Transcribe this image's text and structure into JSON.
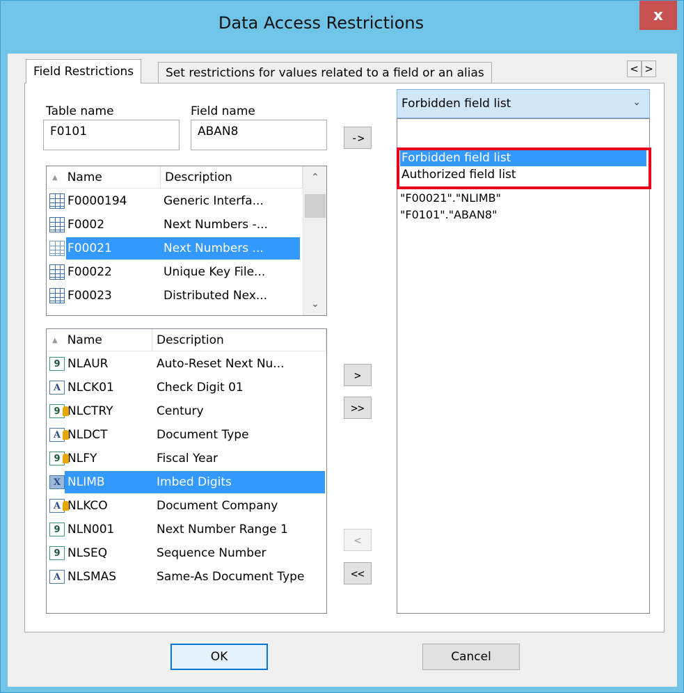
{
  "window": {
    "title": "Data Access Restrictions",
    "close": "x"
  },
  "tabs": [
    {
      "label": "Field Restrictions"
    },
    {
      "label": "Set restrictions for values related to a field or an alias"
    }
  ],
  "tab_scroll": {
    "left": "<",
    "right": ">"
  },
  "table_name": {
    "label": "Table name",
    "value": "F0101"
  },
  "field_name": {
    "label": "Field name",
    "value": "ABAN8"
  },
  "arrow_button": "->",
  "tables_list": {
    "headers": [
      "Name",
      "Description"
    ],
    "rows": [
      {
        "name": "F0000194",
        "desc": "Generic Interfa...",
        "selected": false
      },
      {
        "name": "F0002",
        "desc": "Next Numbers -...",
        "selected": false
      },
      {
        "name": "F00021",
        "desc": "Next Numbers ...",
        "selected": true
      },
      {
        "name": "F00022",
        "desc": "Unique Key File...",
        "selected": false
      },
      {
        "name": "F00023",
        "desc": "Distributed Nex...",
        "selected": false
      }
    ]
  },
  "fields_list": {
    "headers": [
      "Name",
      "Description"
    ],
    "rows": [
      {
        "icon": "9",
        "key": false,
        "name": "NLAUR",
        "desc": "Auto-Reset Next Nu...",
        "selected": false
      },
      {
        "icon": "A",
        "key": false,
        "name": "NLCK01",
        "desc": "Check Digit 01",
        "selected": false
      },
      {
        "icon": "9",
        "key": true,
        "name": "NLCTRY",
        "desc": "Century",
        "selected": false
      },
      {
        "icon": "A",
        "key": true,
        "name": "NLDCT",
        "desc": "Document Type",
        "selected": false
      },
      {
        "icon": "9",
        "key": true,
        "name": "NLFY",
        "desc": "Fiscal Year",
        "selected": false
      },
      {
        "icon": "X",
        "key": false,
        "name": "NLIMB",
        "desc": "Imbed Digits",
        "selected": true
      },
      {
        "icon": "A",
        "key": true,
        "name": "NLKCO",
        "desc": "Document Company",
        "selected": false
      },
      {
        "icon": "9",
        "key": false,
        "name": "NLN001",
        "desc": "Next Number Range 1",
        "selected": false
      },
      {
        "icon": "9",
        "key": false,
        "name": "NLSEQ",
        "desc": "Sequence Number",
        "selected": false
      },
      {
        "icon": "A",
        "key": false,
        "name": "NLSMAS",
        "desc": "Same-As Document Type",
        "selected": false
      }
    ]
  },
  "move_buttons": {
    "add": ">",
    "add_all": ">>",
    "remove": "<",
    "remove_all": "<<"
  },
  "list_type": {
    "selected": "Forbidden field list",
    "options": [
      "Forbidden field list",
      "Authorized field list"
    ]
  },
  "restricted_items": [
    "\"F00021\".\"NLIMB\"",
    "\"F0101\".\"ABAN8\""
  ],
  "footer": {
    "ok": "OK",
    "cancel": "Cancel"
  }
}
